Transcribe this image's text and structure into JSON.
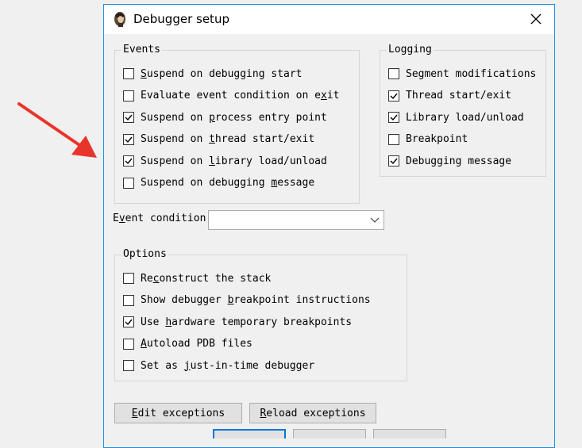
{
  "dialog": {
    "title": "Debugger setup",
    "app_icon": "ida-portrait-icon",
    "close_icon": "close-icon"
  },
  "events": {
    "legend": "Events",
    "items": [
      {
        "pre": "",
        "key": "S",
        "post": "uspend on debugging start",
        "checked": false
      },
      {
        "pre": "Evaluate event condition on e",
        "key": "x",
        "post": "it",
        "checked": false
      },
      {
        "pre": "Suspend on ",
        "key": "p",
        "post": "rocess entry point",
        "checked": true
      },
      {
        "pre": "Suspend on ",
        "key": "t",
        "post": "hread start/exit",
        "checked": true
      },
      {
        "pre": "Suspend on ",
        "key": "l",
        "post": "ibrary load/unload",
        "checked": true
      },
      {
        "pre": "Suspend on debugging ",
        "key": "m",
        "post": "essage",
        "checked": false
      }
    ]
  },
  "logging": {
    "legend": "Logging",
    "items": [
      {
        "pre": "Segment modifications",
        "key": "",
        "post": "",
        "checked": false
      },
      {
        "pre": "Thread start/exit",
        "key": "",
        "post": "",
        "checked": true
      },
      {
        "pre": "Library load/unload",
        "key": "",
        "post": "",
        "checked": true
      },
      {
        "pre": "Breakpoint",
        "key": "",
        "post": "",
        "checked": false
      },
      {
        "pre": "Debugging message",
        "key": "",
        "post": "",
        "checked": true
      }
    ]
  },
  "event_condition": {
    "label_pre": "E",
    "label_key": "v",
    "label_post": "ent condition",
    "value": ""
  },
  "options": {
    "legend": "Options",
    "items": [
      {
        "pre": "Re",
        "key": "c",
        "post": "onstruct the stack",
        "checked": false
      },
      {
        "pre": "Show debugger ",
        "key": "b",
        "post": "reakpoint instructions",
        "checked": false
      },
      {
        "pre": "Use ",
        "key": "h",
        "post": "ardware temporary breakpoints",
        "checked": true
      },
      {
        "pre": "",
        "key": "A",
        "post": "utoload PDB files",
        "checked": false
      },
      {
        "pre": "Set as ",
        "key": "j",
        "post": "ust-in-time debugger",
        "checked": false
      }
    ]
  },
  "buttons": {
    "edit": {
      "key": "E",
      "post": "dit exceptions"
    },
    "reload": {
      "key": "R",
      "post": "eload exceptions"
    }
  },
  "colors": {
    "arrow": "#e8352b",
    "title_border": "#1e90e0",
    "default_button": "#0078d7"
  }
}
